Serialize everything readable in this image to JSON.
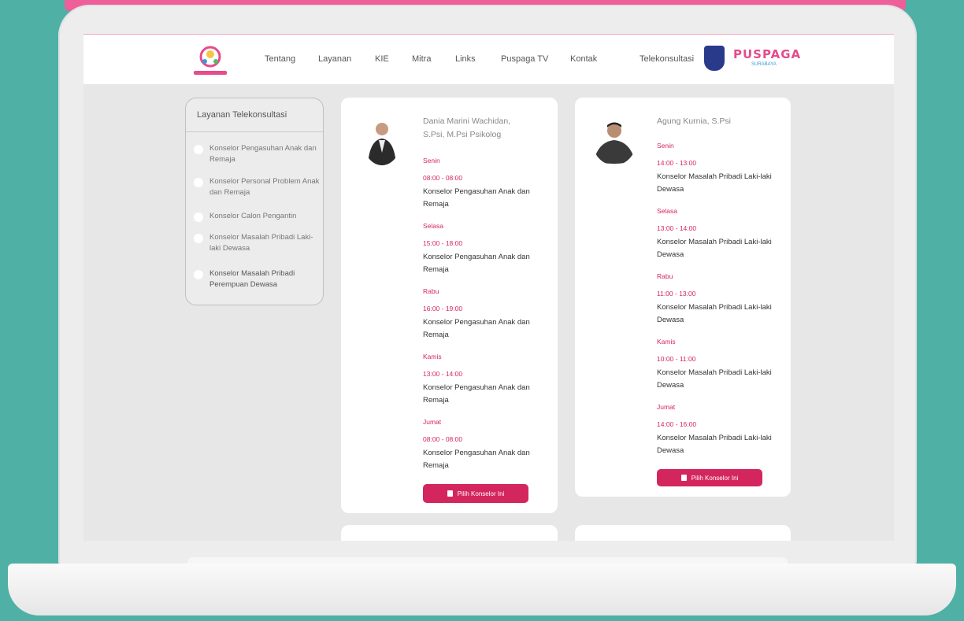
{
  "nav": {
    "items": [
      "Tentang",
      "Layanan",
      "KIE",
      "Mitra",
      "Links",
      "Puspaga TV",
      "Kontak",
      "Telekonsultasi"
    ],
    "brand": "PUSPAGA",
    "brand_sub": "SURABAYA"
  },
  "sidebar": {
    "title": "Layanan Telekonsultasi",
    "filters": [
      "Konselor Pengasuhan Anak dan Remaja",
      "Konselor Personal Problem Anak dan Remaja",
      "Konselor Calon Pengantin",
      "Konselor Masalah Pribadi Laki-laki Dewasa",
      "Konselor Masalah Pribadi Perempuan Dewasa"
    ]
  },
  "counselors": [
    {
      "name": "Dania Marini Wachidan, S.Psi, M.Psi Psikolog",
      "schedule": [
        {
          "day": "Senin",
          "time": "08:00 - 08:00",
          "service": "Konselor Pengasuhan Anak dan Remaja"
        },
        {
          "day": "Selasa",
          "time": "15:00 - 18:00",
          "service": "Konselor Pengasuhan Anak dan Remaja"
        },
        {
          "day": "Rabu",
          "time": "16:00 - 19:00",
          "service": "Konselor Pengasuhan Anak dan Remaja"
        },
        {
          "day": "Kamis",
          "time": "13:00 - 14:00",
          "service": "Konselor Pengasuhan Anak dan Remaja"
        },
        {
          "day": "Jumat",
          "time": "08:00 - 08:00",
          "service": "Konselor Pengasuhan Anak dan Remaja"
        }
      ],
      "button": "Pilih Konselor Ini"
    },
    {
      "name": "Agung Kurnia, S.Psi",
      "schedule": [
        {
          "day": "Senin",
          "time": "14:00 - 13:00",
          "service": "Konselor Masalah Pribadi Laki-laki Dewasa"
        },
        {
          "day": "Selasa",
          "time": "13:00 - 14:00",
          "service": "Konselor Masalah Pribadi Laki-laki Dewasa"
        },
        {
          "day": "Rabu",
          "time": "11:00 - 13:00",
          "service": "Konselor Masalah Pribadi Laki-laki Dewasa"
        },
        {
          "day": "Kamis",
          "time": "10:00 - 11:00",
          "service": "Konselor Masalah Pribadi Laki-laki Dewasa"
        },
        {
          "day": "Jumat",
          "time": "14:00 - 16:00",
          "service": "Konselor Masalah Pribadi Laki-laki Dewasa"
        }
      ],
      "button": "Pilih Konselor Ini"
    }
  ],
  "colors": {
    "accent": "#d4265e",
    "frame_pink": "#ee5f99",
    "background": "#4fb0a6"
  }
}
